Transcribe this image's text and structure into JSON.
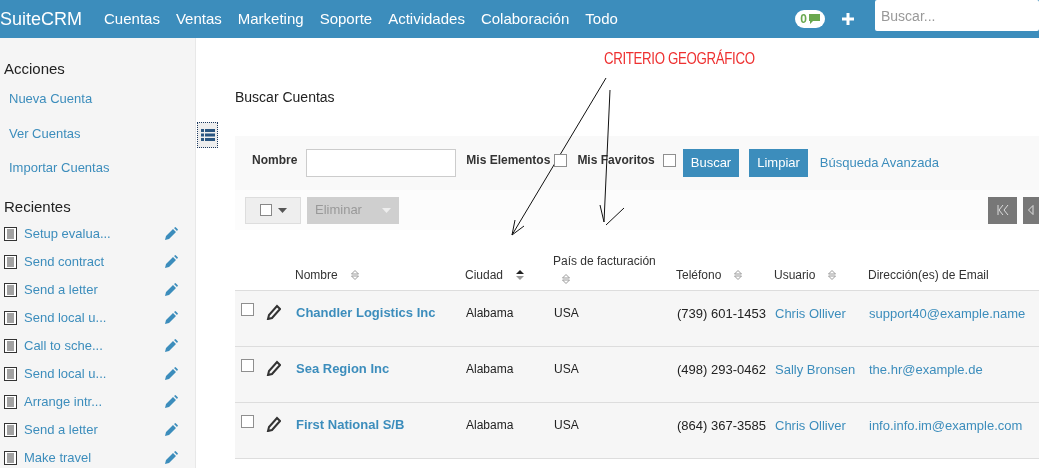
{
  "topbar": {
    "brand": "SuiteCRM",
    "menu": [
      "Cuentas",
      "Ventas",
      "Marketing",
      "Soporte",
      "Actividades",
      "Colaboración",
      "Todo"
    ],
    "notifications": "0",
    "search": {
      "placeholder": "Buscar..."
    }
  },
  "sidebar": {
    "actions_title": "Acciones",
    "actions": [
      "Nueva Cuenta",
      "Ver Cuentas",
      "Importar Cuentas"
    ],
    "recent_title": "Recientes",
    "recent": [
      "Setup evalua...",
      "Send contract",
      "Send a letter",
      "Send local u...",
      "Call to sche...",
      "Send local u...",
      "Arrange intr...",
      "Send a letter",
      "Make travel"
    ]
  },
  "annotation": "CRITERIO GEOGRÁFICO",
  "page_title": "Buscar Cuentas",
  "search_form": {
    "name_label": "Nombre",
    "my_items_label": "Mis Elementos",
    "my_items_checked": false,
    "favorites_label": "Mis Favoritos",
    "favorites_checked": false,
    "search_button": "Buscar",
    "clear_button": "Limpiar",
    "advanced_link": "Búsqueda Avanzada"
  },
  "bulk": {
    "select_all_checked": false,
    "delete_button": "Eliminar"
  },
  "table": {
    "columns": [
      {
        "label": "Nombre",
        "sortable": true,
        "sorted": false
      },
      {
        "label": "Ciudad",
        "sortable": true,
        "sorted": true
      },
      {
        "label": "País de facturación",
        "sortable": true,
        "sorted": false
      },
      {
        "label": "Teléfono",
        "sortable": true,
        "sorted": false
      },
      {
        "label": "Usuario",
        "sortable": true,
        "sorted": false
      },
      {
        "label": "Dirección(es) de Email",
        "sortable": false
      }
    ],
    "rows": [
      {
        "checked": false,
        "name": "Chandler Logistics Inc",
        "city": "Alabama",
        "country": "USA",
        "phone": "(739) 601-1453",
        "user": "Chris Olliver",
        "email": "support40@example.name"
      },
      {
        "checked": false,
        "name": "Sea Region Inc",
        "city": "Alabama",
        "country": "USA",
        "phone": "(498) 293-0462",
        "user": "Sally Bronsen",
        "email": "the.hr@example.de"
      },
      {
        "checked": false,
        "name": "First National S/B",
        "city": "Alabama",
        "country": "USA",
        "phone": "(864) 367-3585",
        "user": "Chris Olliver",
        "email": "info.info.im@example.com"
      }
    ]
  }
}
